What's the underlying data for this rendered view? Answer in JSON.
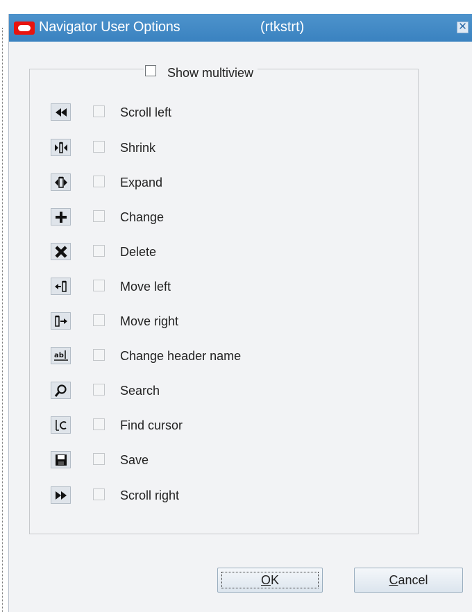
{
  "dialog": {
    "title": "Navigator User Options",
    "user": "(rtkstrt)",
    "close_icon": "close-icon",
    "oracle_logo": "oracle-logo-icon"
  },
  "multiview": {
    "label": "Show multiview",
    "checked": false
  },
  "options": [
    {
      "icon": "scroll-left-icon",
      "label": "Scroll left",
      "checked": false
    },
    {
      "icon": "shrink-icon",
      "label": "Shrink",
      "checked": false
    },
    {
      "icon": "expand-icon",
      "label": "Expand",
      "checked": false
    },
    {
      "icon": "change-icon",
      "label": "Change",
      "checked": false
    },
    {
      "icon": "delete-icon",
      "label": "Delete",
      "checked": false
    },
    {
      "icon": "move-left-icon",
      "label": "Move left",
      "checked": false
    },
    {
      "icon": "move-right-icon",
      "label": "Move right",
      "checked": false
    },
    {
      "icon": "change-header-name-icon",
      "label": "Change header name",
      "checked": false
    },
    {
      "icon": "search-icon",
      "label": "Search",
      "checked": false
    },
    {
      "icon": "find-cursor-icon",
      "label": "Find cursor",
      "checked": false
    },
    {
      "icon": "save-icon",
      "label": "Save",
      "checked": false
    },
    {
      "icon": "scroll-right-icon",
      "label": "Scroll right",
      "checked": false
    }
  ],
  "buttons": {
    "ok": {
      "accel": "O",
      "rest": "K"
    },
    "cancel": {
      "accel": "C",
      "rest": "ancel"
    }
  },
  "colors": {
    "titlebar": "#3a82c0",
    "oracle_red": "#e8140f",
    "dialog_bg": "#f2f3f5"
  }
}
